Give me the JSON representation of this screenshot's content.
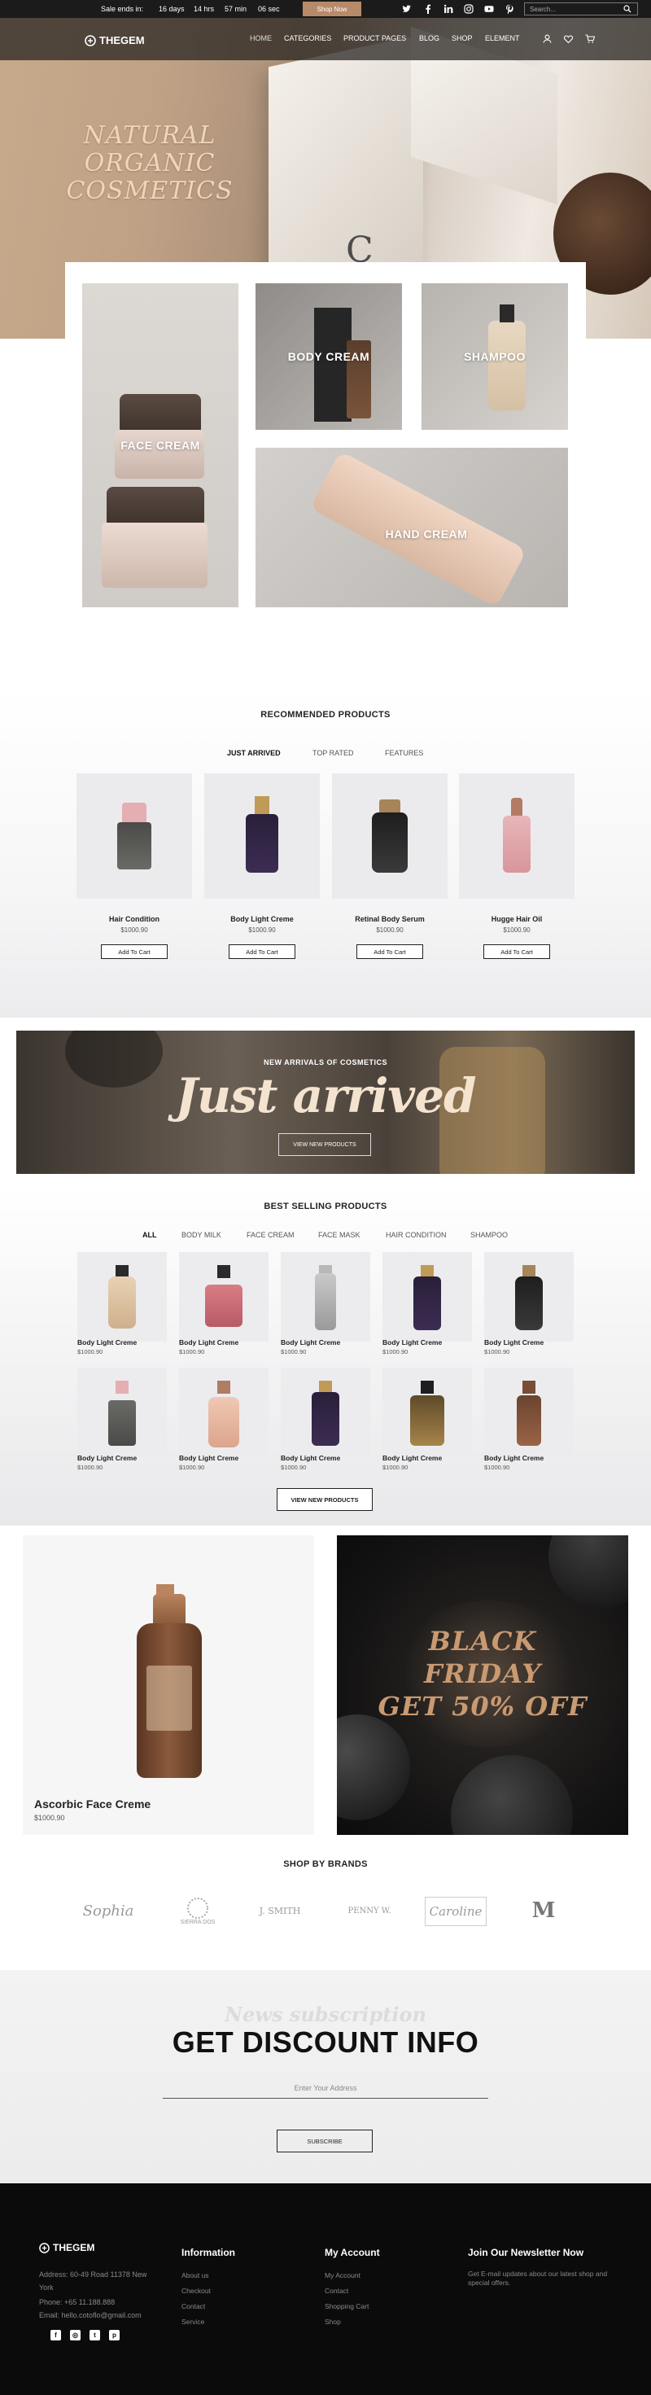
{
  "topbar": {
    "sale_label": "Sale ends in:",
    "days": "16 days",
    "hours": "14 hrs",
    "minutes": "57 min",
    "seconds": "06 sec",
    "shop_now": "Shop Now",
    "search_placeholder": "Search...",
    "social_icons": [
      "twitter-icon",
      "facebook-icon",
      "linkedin-icon",
      "instagram-icon",
      "youtube-icon",
      "pinterest-icon"
    ]
  },
  "header": {
    "logo": "THEGEM",
    "nav": [
      "HOME",
      "CATEGORIES",
      "PRODUCT PAGES",
      "BLOG",
      "SHOP",
      "ELEMENT"
    ]
  },
  "hero": {
    "title_line1": "NATURAL ORGANIC",
    "title_line2": "COSMETICS"
  },
  "categories": {
    "face_cream": "FACE CREAM",
    "body_cream": "BODY CREAM",
    "shampoo": "SHAMPOO",
    "hand_cream": "HAND CREAM"
  },
  "recommended": {
    "title": "RECOMMENDED PRODUCTS",
    "tabs": [
      "JUST ARRIVED",
      "TOP RATED",
      "FEATURES"
    ],
    "add_to_cart": "Add To Cart",
    "products": [
      {
        "name": "Hair Condition",
        "price": "$1000.90"
      },
      {
        "name": "Body Light Creme",
        "price": "$1000.90"
      },
      {
        "name": "Retinal Body Serum",
        "price": "$1000.90"
      },
      {
        "name": "Hugge Hair Oil",
        "price": "$1000.90"
      }
    ]
  },
  "banner": {
    "subtitle": "NEW ARRIVALS OF COSMETICS",
    "headline": "Just arrived",
    "button": "VIEW NEW PRODUCTS"
  },
  "best_selling": {
    "title": "BEST SELLING PRODUCTS",
    "tabs": [
      "ALL",
      "BODY MILK",
      "FACE CREAM",
      "FACE MASK",
      "HAIR CONDITION",
      "SHAMPOO"
    ],
    "products": [
      {
        "name": "Body Light Creme",
        "price": "$1000.90"
      },
      {
        "name": "Body Light Creme",
        "price": "$1000.90"
      },
      {
        "name": "Body Light Creme",
        "price": "$1000.90"
      },
      {
        "name": "Body Light Creme",
        "price": "$1000.90"
      },
      {
        "name": "Body Light Creme",
        "price": "$1000.90"
      },
      {
        "name": "Body Light Creme",
        "price": "$1000.90"
      },
      {
        "name": "Body Light Creme",
        "price": "$1000.90"
      },
      {
        "name": "Body Light Creme",
        "price": "$1000.90"
      },
      {
        "name": "Body Light Creme",
        "price": "$1000.90"
      },
      {
        "name": "Body Light Creme",
        "price": "$1000.90"
      }
    ],
    "button": "VIEW NEW PRODUCTS"
  },
  "featured": {
    "name": "Ascorbic Face Creme",
    "price": "$1000.90",
    "promo_line1": "BLACK",
    "promo_line2": "FRIDAY",
    "promo_line3": "GET 50% OFF"
  },
  "brands": {
    "title": "SHOP BY BRANDS",
    "items": [
      "Sophia",
      "SIERRA DOS",
      "J. SMITH",
      "PENNY W.",
      "Caroline",
      "M"
    ]
  },
  "newsletter": {
    "ghost": "News subscription",
    "title": "GET DISCOUNT INFO",
    "placeholder": "Enter Your Address",
    "button": "SUBSCRIBE"
  },
  "footer": {
    "logo": "THEGEM",
    "address": "Address: 60-49 Road 11378 New York",
    "phone": "Phone: +65 11.188.888",
    "email": "Email: hello.cotoflo@gmail.com",
    "info_title": "Information",
    "info_links": [
      "About us",
      "Checkout",
      "Contact",
      "Service"
    ],
    "account_title": "My Account",
    "account_links": [
      "My Account",
      "Contact",
      "Shopping Cart",
      "Shop"
    ],
    "newsletter_title": "Join Our Newsletter Now",
    "newsletter_text": "Get E-mail updates about our latest shop and special offers."
  },
  "colors": {
    "accent": "#b78a6a",
    "dark": "#1b1b1b",
    "footer_bg": "#0b0b0b"
  }
}
